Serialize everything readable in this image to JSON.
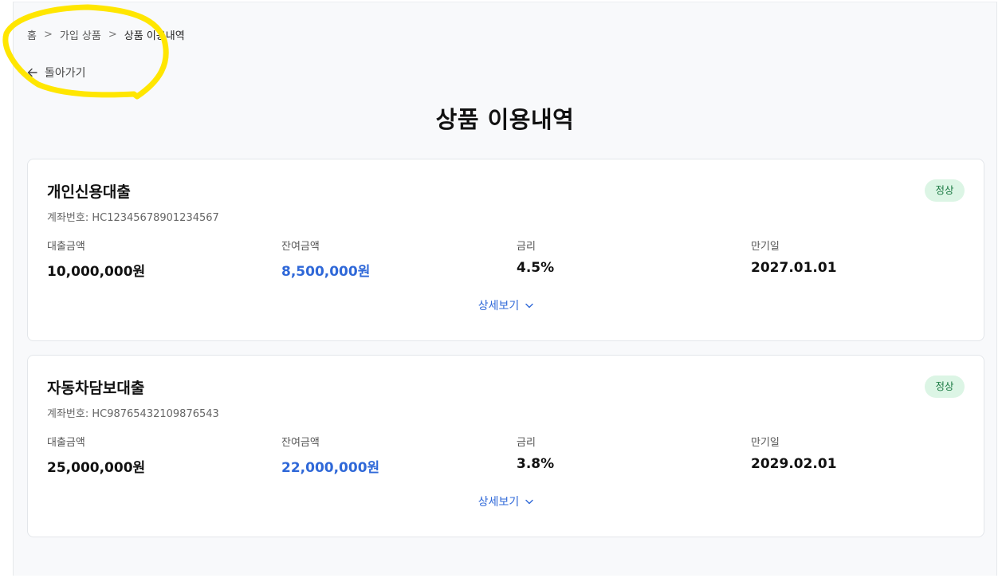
{
  "breadcrumb": {
    "items": [
      "홈",
      "가입 상품",
      "상품 이용내역"
    ],
    "separator": ">"
  },
  "back": {
    "label": "돌아가기",
    "icon": "arrow-left-icon"
  },
  "page_title": "상품 이용내역",
  "products": [
    {
      "name": "개인신용대출",
      "account": "계좌번호: HC12345678901234567",
      "status": "정상",
      "fields": {
        "loan_amount_label": "대출금액",
        "loan_amount": "10,000,000원",
        "balance_label": "잔여금액",
        "balance": "8,500,000원",
        "rate_label": "금리",
        "rate": "4.5%",
        "maturity_label": "만기일",
        "maturity": "2027.01.01"
      },
      "detail_label": "상세보기"
    },
    {
      "name": "자동차담보대출",
      "account": "계좌번호: HC98765432109876543",
      "status": "정상",
      "fields": {
        "loan_amount_label": "대출금액",
        "loan_amount": "25,000,000원",
        "balance_label": "잔여금액",
        "balance": "22,000,000원",
        "rate_label": "금리",
        "rate": "3.8%",
        "maturity_label": "만기일",
        "maturity": "2029.02.01"
      },
      "detail_label": "상세보기"
    }
  ],
  "colors": {
    "accent_blue": "#2f68d8",
    "badge_bg": "#dcf5e5",
    "badge_text": "#1b7a43",
    "highlight_yellow": "#ffe600",
    "page_bg": "#f8f9fb"
  }
}
